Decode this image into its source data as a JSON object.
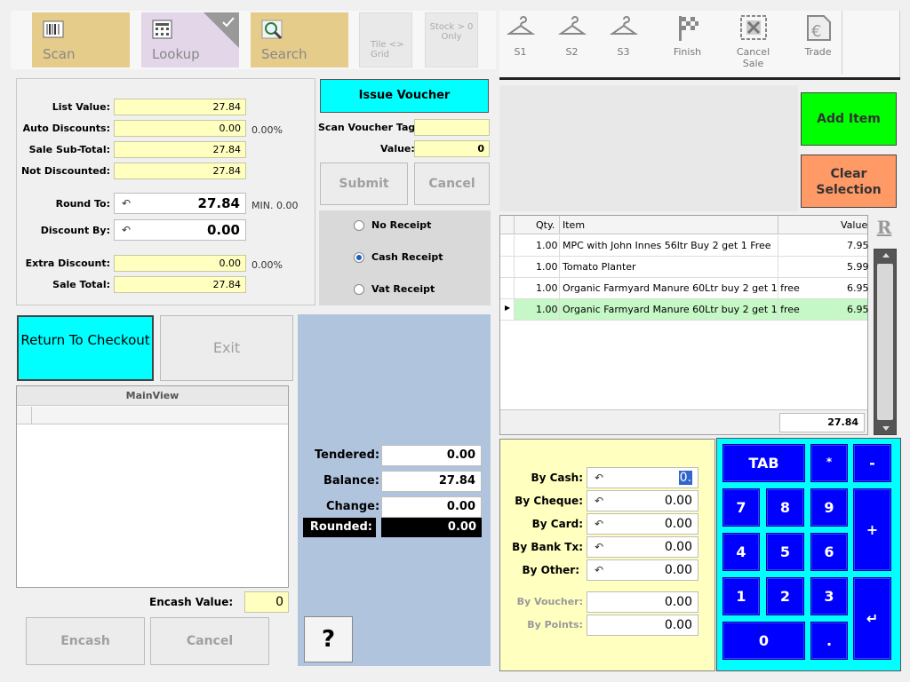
{
  "toolbar": {
    "scan": "Scan",
    "lookup": "Lookup",
    "search": "Search",
    "tile_grid": "Tile <> Grid",
    "stock_only": "Stock > 0 Only"
  },
  "right_toolbar": [
    {
      "label": "S1",
      "icon": "hanger-icon"
    },
    {
      "label": "S2",
      "icon": "hanger-icon"
    },
    {
      "label": "S3",
      "icon": "hanger-icon"
    },
    {
      "label": "Finish",
      "icon": "finish-flag-icon"
    },
    {
      "label": "Cancel Sale",
      "icon": "cancel-sale-icon"
    },
    {
      "label": "Trade",
      "icon": "trade-euro-icon"
    }
  ],
  "totals": {
    "list_value_label": "List Value:",
    "list_value": "27.84",
    "auto_discounts_label": "Auto Discounts:",
    "auto_discounts": "0.00",
    "auto_discounts_pct": "0.00%",
    "sale_subtotal_label": "Sale Sub-Total:",
    "sale_subtotal": "27.84",
    "not_discounted_label": "Not Discounted:",
    "not_discounted": "27.84",
    "round_to_label": "Round To:",
    "round_to": "27.84",
    "min_label": "MIN. 0.00",
    "discount_by_label": "Discount By:",
    "discount_by": "0.00",
    "extra_discount_label": "Extra Discount:",
    "extra_discount": "0.00",
    "extra_discount_pct": "0.00%",
    "sale_total_label": "Sale Total:",
    "sale_total": "27.84"
  },
  "voucher": {
    "issue_label": "Issue Voucher",
    "scan_tag_label": "Scan Voucher Tag:",
    "scan_tag_value": "",
    "value_label": "Value:",
    "value": "0",
    "submit_label": "Submit",
    "cancel_label": "Cancel"
  },
  "receipt_options": [
    {
      "label": "No Receipt",
      "selected": false
    },
    {
      "label": "Cash Receipt",
      "selected": true
    },
    {
      "label": "Vat Receipt",
      "selected": false
    }
  ],
  "actions": {
    "return_checkout": "Return To Checkout",
    "exit": "Exit"
  },
  "mainview": {
    "title": "MainView"
  },
  "encash": {
    "value_label": "Encash Value:",
    "value": "0",
    "encash_label": "Encash",
    "cancel_label": "Cancel"
  },
  "tender": {
    "tendered_label": "Tendered:",
    "tendered": "0.00",
    "balance_label": "Balance:",
    "balance": "27.84",
    "change_label": "Change:",
    "change": "0.00",
    "rounded_label": "Rounded:",
    "rounded": "0.00",
    "help_label": "?"
  },
  "item_buttons": {
    "add_item": "Add Item",
    "clear_selection": "Clear Selection"
  },
  "items_table": {
    "headers": {
      "qty": "Qty.",
      "item": "Item",
      "value": "Value"
    },
    "rows": [
      {
        "qty": "1.00",
        "item": "MPC with John Innes 56ltr Buy 2 get 1 Free",
        "value": "7.95"
      },
      {
        "qty": "1.00",
        "item": "Tomato Planter",
        "value": "5.99"
      },
      {
        "qty": "1.00",
        "item": "Organic Farmyard Manure 60Ltr buy 2 get 1 free",
        "value": "6.95"
      },
      {
        "qty": "1.00",
        "item": "Organic Farmyard Manure 60Ltr buy 2 get 1 free",
        "value": "6.95"
      }
    ],
    "total": "27.84",
    "r_label": "R"
  },
  "payments": {
    "cash_label": "By Cash:",
    "cash": "0.",
    "cheque_label": "By Cheque:",
    "cheque": "0.00",
    "card_label": "By Card:",
    "card": "0.00",
    "banktx_label": "By Bank Tx:",
    "banktx": "0.00",
    "other_label": "By Other:",
    "other": "0.00",
    "voucher_label": "By Voucher:",
    "voucher": "0.00",
    "points_label": "By Points:",
    "points": "0.00"
  },
  "keypad": {
    "tab": "TAB",
    "star": "*",
    "minus": "-",
    "plus": "+",
    "enter": "↵",
    "k7": "7",
    "k8": "8",
    "k9": "9",
    "k4": "4",
    "k5": "5",
    "k6": "6",
    "k1": "1",
    "k2": "2",
    "k3": "3",
    "k0": "0",
    "dot": "."
  },
  "colors": {
    "accent_cyan": "#00ffff",
    "add_green": "#00ff00",
    "clear_salmon": "#ff9966",
    "keypad_blue": "#0000ff",
    "field_yellow": "#ffffc0",
    "selected_row": "#c6f7c6"
  }
}
